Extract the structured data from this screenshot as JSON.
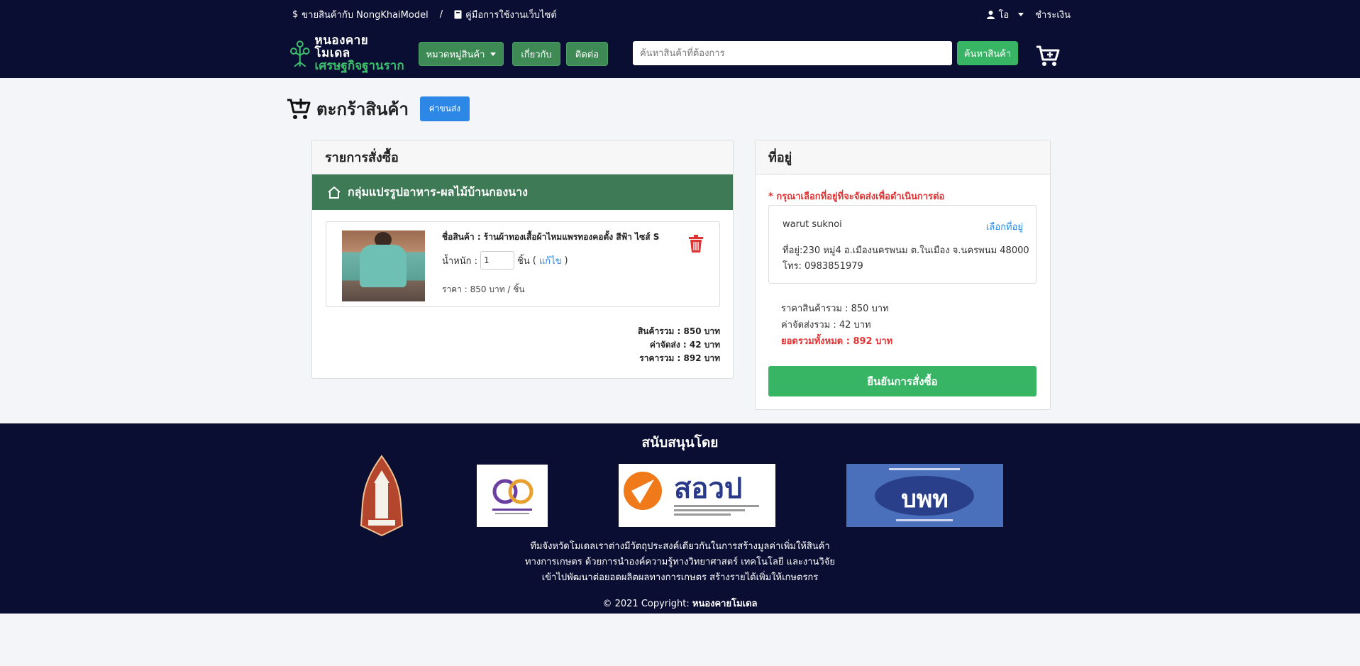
{
  "topbar": {
    "sell_link": "ขายสินค้ากับ NongKhaiModel",
    "separator": "/",
    "manual_link": "คู่มือการใช้งานเว็บไซต์",
    "user_name": "โอ",
    "payment_link": "ชำระเงิน"
  },
  "header": {
    "logo_line1": "หนองคาย โมเดล",
    "logo_line2": "เศรษฐกิจฐานราก",
    "category_button": "หมวดหมู่สินค้า",
    "about_button": "เกี่ยวกับ",
    "contact_button": "ติดต่อ",
    "search_placeholder": "ค้นหาสินค้าที่ต้องการ",
    "search_button": "ค้นหาสินค้า"
  },
  "page": {
    "title": "ตะกร้าสินค้า",
    "shipping_button": "ค่าขนส่ง"
  },
  "order": {
    "header": "รายการสั่งซื้อ",
    "shop_name": "กลุ่มแปรรูปอาหาร-ผลไม้บ้านกองนาง",
    "item": {
      "name": "ชื่อสินค้า : ร้านผ้าทองเสื้อผ้าไหมแพรทองคอตั้ง สีฟ้า ไซส์ S",
      "weight_label": "น้ำหนัก :",
      "quantity": "1",
      "unit": "ชิ้น",
      "edit_open": "(",
      "edit_link": "แก้ไข",
      "edit_close": ")",
      "price": "ราคา : 850 บาท / ชิ้น"
    },
    "summary": {
      "subtotal": "สินค้ารวม : 850 บาท",
      "shipping": "ค่าจัดส่ง : 42 บาท",
      "total": "ราคารวม : 892 บาท"
    }
  },
  "address": {
    "header": "ที่อยู่",
    "warning": "* กรุณาเลือกที่อยู่ที่จะจัดส่งเพื่อดำเนินการต่อ",
    "name": "warut suknoi",
    "select_link": "เลือกที่อยู่",
    "line": "ที่อยู่:230 หมู่4 อ.เมืองนครพนม ต.ในเมือง จ.นครพนม 48000",
    "phone": "โทร: 0983851979",
    "product_total": "ราคาสินค้ารวม : 850 บาท",
    "shipping_total": "ค่าจัดส่งรวม : 42 บาท",
    "grand_total": "ยอดรวมทั้งหมด : 892 บาท",
    "confirm_button": "ยืนยันการสั่งซื้อ"
  },
  "footer": {
    "sponsor_title": "สนับสนุนโดย",
    "sponsor_logo_3": "สอวป",
    "sponsor_logo_4": "บพท",
    "text_line1": "ทีมจังหวัดโมเดลเราต่างมีวัตถุประสงค์เดียวกันในการสร้างมูลค่าเพิ่มให้สินค้า",
    "text_line2": "ทางการเกษตร ด้วยการนำองค์ความรู้ทางวิทยาศาสตร์ เทคโนโลยี และงานวิจัย",
    "text_line3": "เข้าไปพัฒนาต่อยอดผลิตผลทางการเกษตร สร้างรายได้เพิ่มให้เกษตรกร",
    "copyright_prefix": "© 2021 Copyright:",
    "copyright_brand": "หนองคายโมเดล"
  },
  "colors": {
    "navy": "#0b0e33",
    "green": "#37b564",
    "dark_green": "#3d7a55",
    "blue": "#2c87e6",
    "red": "#e03333"
  }
}
